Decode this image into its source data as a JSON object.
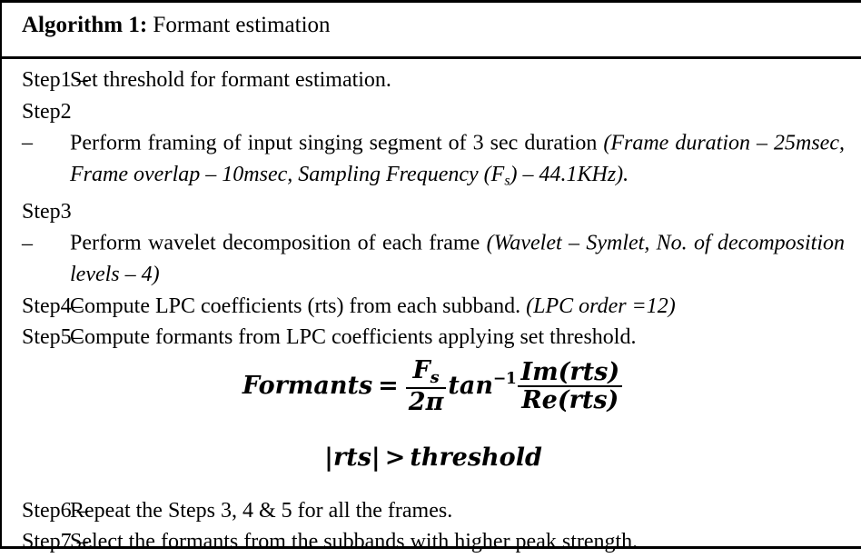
{
  "caption": {
    "label": "Algorithm 1:",
    "title": " Formant estimation"
  },
  "steps": [
    {
      "tag": "Step1",
      "dash": " – ",
      "text": "Set threshold for formant estimation.",
      "style": "plain"
    },
    {
      "tag": "Step2",
      "dash": " – ",
      "text": "Perform framing of input singing segment of 3 sec duration ",
      "italic_part_1": "(Frame duration – 25msec, Frame overlap – 10msec, Sampling Frequency (F",
      "italic_sub": "s",
      "italic_part_2": ") – 44.1KHz).",
      "style": "justified"
    },
    {
      "tag": "Step3",
      "dash": " – ",
      "text": "Perform wavelet decomposition of each frame ",
      "italic_part_1": "(Wavelet – Symlet, No. of decomposition levels – 4)",
      "style": "justified"
    },
    {
      "tag": "Step4–",
      "dash": " ",
      "text": "Compute LPC coefficients (rts) from each subband. ",
      "italic_part_1": "(LPC order =12)",
      "style": "justified"
    },
    {
      "tag": "Step5–",
      "dash": " ",
      "text": "Compute formants from LPC coefficients applying set threshold.",
      "style": "plain"
    }
  ],
  "formula": {
    "lhs": "Formants",
    "equals": "=",
    "frac1_num": "F",
    "frac1_num_sub": "s",
    "frac1_den": "2π",
    "function": "tan",
    "exponent": "−1",
    "frac2_num": "Im(rts)",
    "frac2_den": "Re(rts)"
  },
  "condition": {
    "lhs": "|rts|",
    "operator": ">",
    "rhs": "threshold"
  },
  "steps_after": [
    {
      "tag": "Step6",
      "dash": " – ",
      "text": "Repeat the Steps 3, 4 & 5 for all the frames.",
      "style": "plain"
    },
    {
      "tag": "Step7",
      "dash": " –.",
      "text": "Select the formants from the subbands with higher peak strength.",
      "style": "plain"
    }
  ],
  "colors": {
    "text": "#000000",
    "rule": "#000000",
    "background": "#ffffff"
  }
}
